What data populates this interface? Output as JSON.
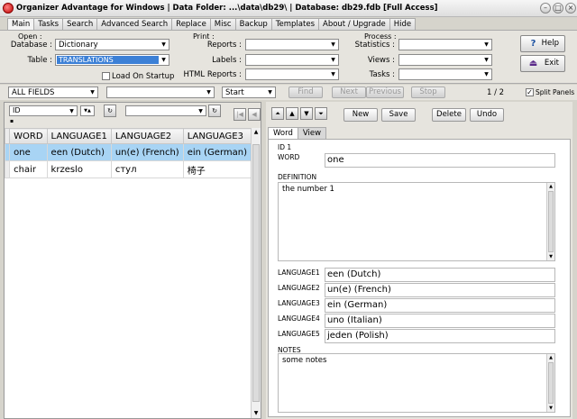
{
  "window": {
    "title": "Organizer Advantage for Windows | Data Folder: ...\\data\\db29\\ | Database: db29.fdb [Full Access]"
  },
  "tabs": [
    "Main",
    "Tasks",
    "Search",
    "Advanced Search",
    "Replace",
    "Misc",
    "Backup",
    "Templates",
    "About / Upgrade",
    "Hide"
  ],
  "open": {
    "title": "Open :",
    "database_label": "Database :",
    "database_value": "Dictionary",
    "table_label": "Table :",
    "table_value": "TRANSLATIONS",
    "load_on_startup": "Load On Startup"
  },
  "print": {
    "title": "Print :",
    "reports_label": "Reports :",
    "labels_label": "Labels :",
    "html_reports_label": "HTML Reports :"
  },
  "process": {
    "title": "Process :",
    "statistics_label": "Statistics :",
    "views_label": "Views :",
    "tasks_label": "Tasks :"
  },
  "side_buttons": {
    "help": "Help",
    "exit": "Exit"
  },
  "filter": {
    "field": "ALL FIELDS",
    "start": "Start",
    "find": "Find",
    "next": "Next",
    "previous": "Previous",
    "stop": "Stop",
    "page": "1 / 2",
    "split_panels": "Split Panels"
  },
  "sort": {
    "field": "ID",
    "direction": "▼▲"
  },
  "grid": {
    "columns": [
      "WORD",
      "LANGUAGE1",
      "LANGUAGE2",
      "LANGUAGE3"
    ],
    "rows": [
      [
        "one",
        "een (Dutch)",
        "un(e) (French)",
        "ein (German)"
      ],
      [
        "chair",
        "krzeslo",
        "стул",
        "椅子"
      ]
    ]
  },
  "record_actions": {
    "new": "New",
    "save": "Save",
    "delete": "Delete",
    "undo": "Undo"
  },
  "record_tabs": [
    "Word",
    "View"
  ],
  "record": {
    "id_label": "ID 1",
    "word_label": "WORD",
    "word": "one",
    "definition_label": "DEFINITION",
    "definition": "the number 1",
    "language1_label": "LANGUAGE1",
    "language1": "een (Dutch)",
    "language2_label": "LANGUAGE2",
    "language2": "un(e) (French)",
    "language3_label": "LANGUAGE3",
    "language3": "ein (German)",
    "language4_label": "LANGUAGE4",
    "language4": "uno (Italian)",
    "language5_label": "LANGUAGE5",
    "language5": "jeden (Polish)",
    "notes_label": "NOTES",
    "notes": "some notes"
  }
}
